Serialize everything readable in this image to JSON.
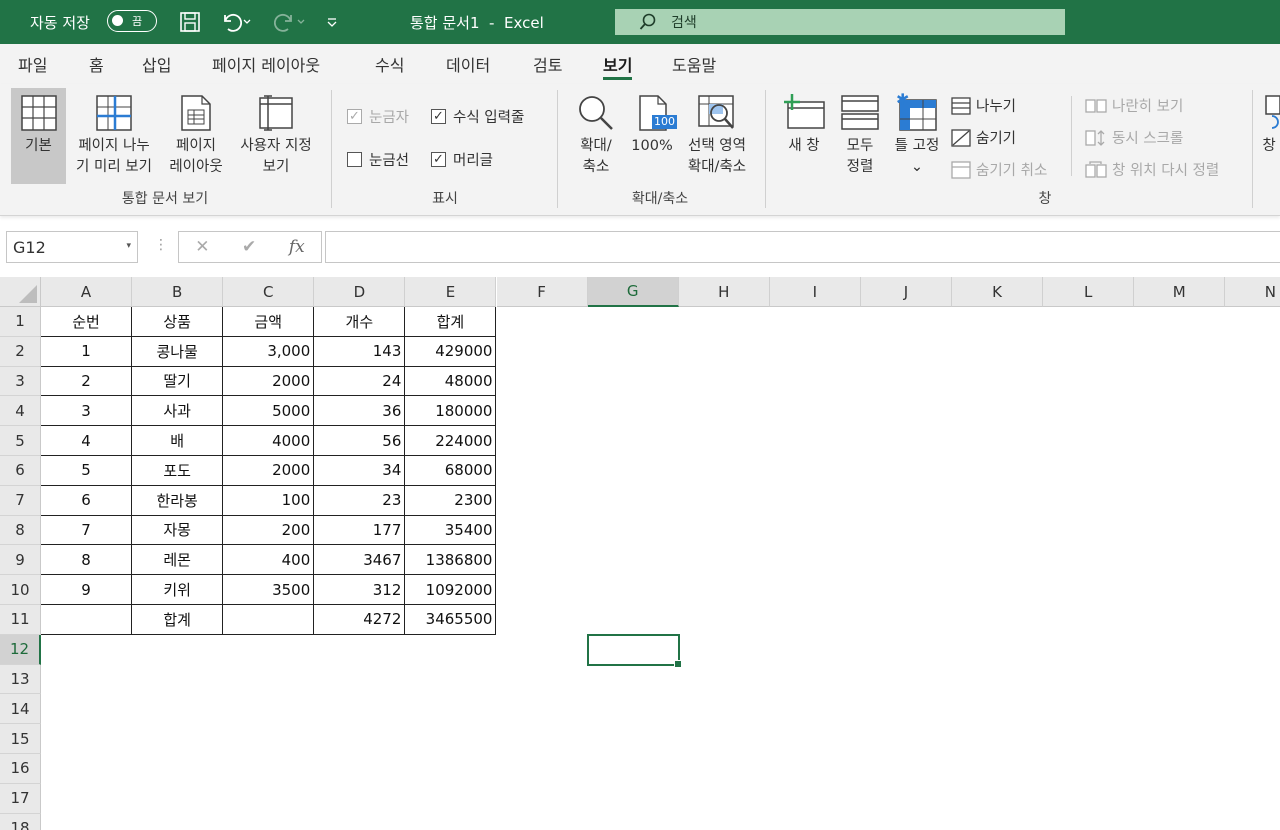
{
  "titlebar": {
    "autosave_label": "자동 저장",
    "autosave_state": "끔",
    "document_title": "통합 문서1  -  Excel",
    "search_label": "검색"
  },
  "tabs": [
    "파일",
    "홈",
    "삽입",
    "페이지 레이아웃",
    "수식",
    "데이터",
    "검토",
    "보기",
    "도움말"
  ],
  "active_tab": "보기",
  "ribbon": {
    "workbook_views": {
      "group_label": "통합 문서 보기",
      "normal": "기본",
      "page_break_1": "페이지 나누",
      "page_break_2": "기 미리 보기",
      "page_layout_1": "페이지",
      "page_layout_2": "레이아웃",
      "custom_1": "사용자 지정",
      "custom_2": "보기"
    },
    "show": {
      "group_label": "표시",
      "ruler": "눈금자",
      "formula_bar": "수식 입력줄",
      "gridlines": "눈금선",
      "headings": "머리글"
    },
    "zoom": {
      "group_label": "확대/축소",
      "zoom_1": "확대/",
      "zoom_2": "축소",
      "hundred": "100%",
      "icon_text": "100",
      "zoom_sel_1": "선택 영역",
      "zoom_sel_2": "확대/축소"
    },
    "window": {
      "group_label": "창",
      "new_window": "새 창",
      "arrange_1": "모두",
      "arrange_2": "정렬",
      "freeze": "틀 고정",
      "freeze_chevron": "⌄",
      "split": "나누기",
      "hide": "숨기기",
      "unhide": "숨기기 취소",
      "side_by_side": "나란히 보기",
      "sync_scroll": "동시 스크롤",
      "reset_position": "창 위치 다시 정렬",
      "switch_partial": "창"
    }
  },
  "formula_bar": {
    "name_box": "G12",
    "dropdown": "▾",
    "dots": "⋮",
    "cancel": "✕",
    "enter": "✔",
    "fx": "fx",
    "value": ""
  },
  "columns": [
    "A",
    "B",
    "C",
    "D",
    "E",
    "F",
    "G",
    "H",
    "I",
    "J",
    "K",
    "L",
    "M",
    "N"
  ],
  "rows": [
    "1",
    "2",
    "3",
    "4",
    "5",
    "6",
    "7",
    "8",
    "9",
    "10",
    "11",
    "12",
    "13",
    "14",
    "15",
    "16",
    "17",
    "18"
  ],
  "selected_cell": "G12",
  "table": [
    [
      "순번",
      "상품",
      "금액",
      "개수",
      "합계"
    ],
    [
      "1",
      "콩나물",
      "3,000",
      "143",
      "429000"
    ],
    [
      "2",
      "딸기",
      "2000",
      "24",
      "48000"
    ],
    [
      "3",
      "사과",
      "5000",
      "36",
      "180000"
    ],
    [
      "4",
      "배",
      "4000",
      "56",
      "224000"
    ],
    [
      "5",
      "포도",
      "2000",
      "34",
      "68000"
    ],
    [
      "6",
      "한라봉",
      "100",
      "23",
      "2300"
    ],
    [
      "7",
      "자몽",
      "200",
      "177",
      "35400"
    ],
    [
      "8",
      "레몬",
      "400",
      "3467",
      "1386800"
    ],
    [
      "9",
      "키위",
      "3500",
      "312",
      "1092000"
    ],
    [
      "",
      "합계",
      "",
      "4272",
      "3465500"
    ]
  ],
  "colors": {
    "excel_green": "#217346",
    "search_bg": "#a8d2b4",
    "ribbon_bg": "#f3f3f3"
  }
}
